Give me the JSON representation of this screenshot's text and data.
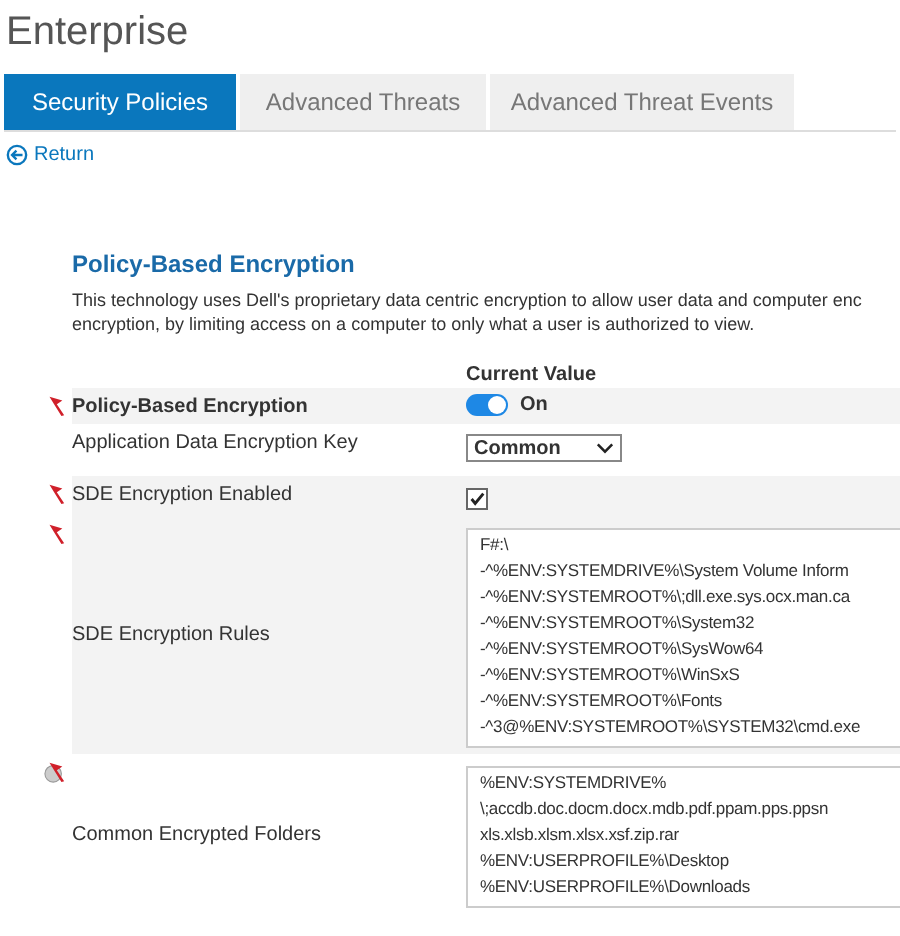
{
  "page_title": "Enterprise",
  "tabs": [
    {
      "label": "Security Policies",
      "selected": true
    },
    {
      "label": "Advanced Threats",
      "selected": false
    },
    {
      "label": "Advanced Threat Events",
      "selected": false
    }
  ],
  "return_link": "Return",
  "section": {
    "title": "Policy-Based Encryption",
    "description": [
      "This technology uses Dell's proprietary data centric encryption to allow user data and computer enc",
      "encryption, by limiting access on a computer to only what a user is authorized to view."
    ],
    "value_header": "Current Value"
  },
  "settings": [
    {
      "label": "Policy-Based Encryption",
      "flagged": true,
      "inherited": false,
      "bold": true,
      "shaded": true,
      "kind": "toggle",
      "on": true,
      "value": "On"
    },
    {
      "label": "Application Data Encryption Key",
      "flagged": false,
      "inherited": false,
      "shaded": false,
      "bold": false,
      "kind": "select",
      "value": "Common"
    },
    {
      "label": "SDE Encryption Enabled",
      "flagged": true,
      "inherited": false,
      "shaded": true,
      "bold": false,
      "kind": "checkbox",
      "checked": true
    },
    {
      "label": "SDE Encryption Rules",
      "flagged": true,
      "inherited": false,
      "shaded": true,
      "bold": false,
      "kind": "list",
      "lines": [
        "F#:\\",
        "-^%ENV:SYSTEMDRIVE%\\System Volume Inform",
        "-^%ENV:SYSTEMROOT%\\;dll.exe.sys.ocx.man.ca",
        "-^%ENV:SYSTEMROOT%\\System32",
        "-^%ENV:SYSTEMROOT%\\SysWow64",
        "-^%ENV:SYSTEMROOT%\\WinSxS",
        "-^%ENV:SYSTEMROOT%\\Fonts",
        "-^3@%ENV:SYSTEMROOT%\\SYSTEM32\\cmd.exe"
      ]
    },
    {
      "label": "Common Encrypted Folders",
      "flagged": true,
      "inherited": true,
      "shaded": false,
      "bold": false,
      "kind": "list",
      "lines": [
        "%ENV:SYSTEMDRIVE%",
        "\\;accdb.doc.docm.docx.mdb.pdf.ppam.pps.ppsn",
        "xls.xlsb.xlsm.xlsx.xsf.zip.rar",
        "%ENV:USERPROFILE%\\Desktop",
        "%ENV:USERPROFILE%\\Downloads"
      ]
    }
  ]
}
